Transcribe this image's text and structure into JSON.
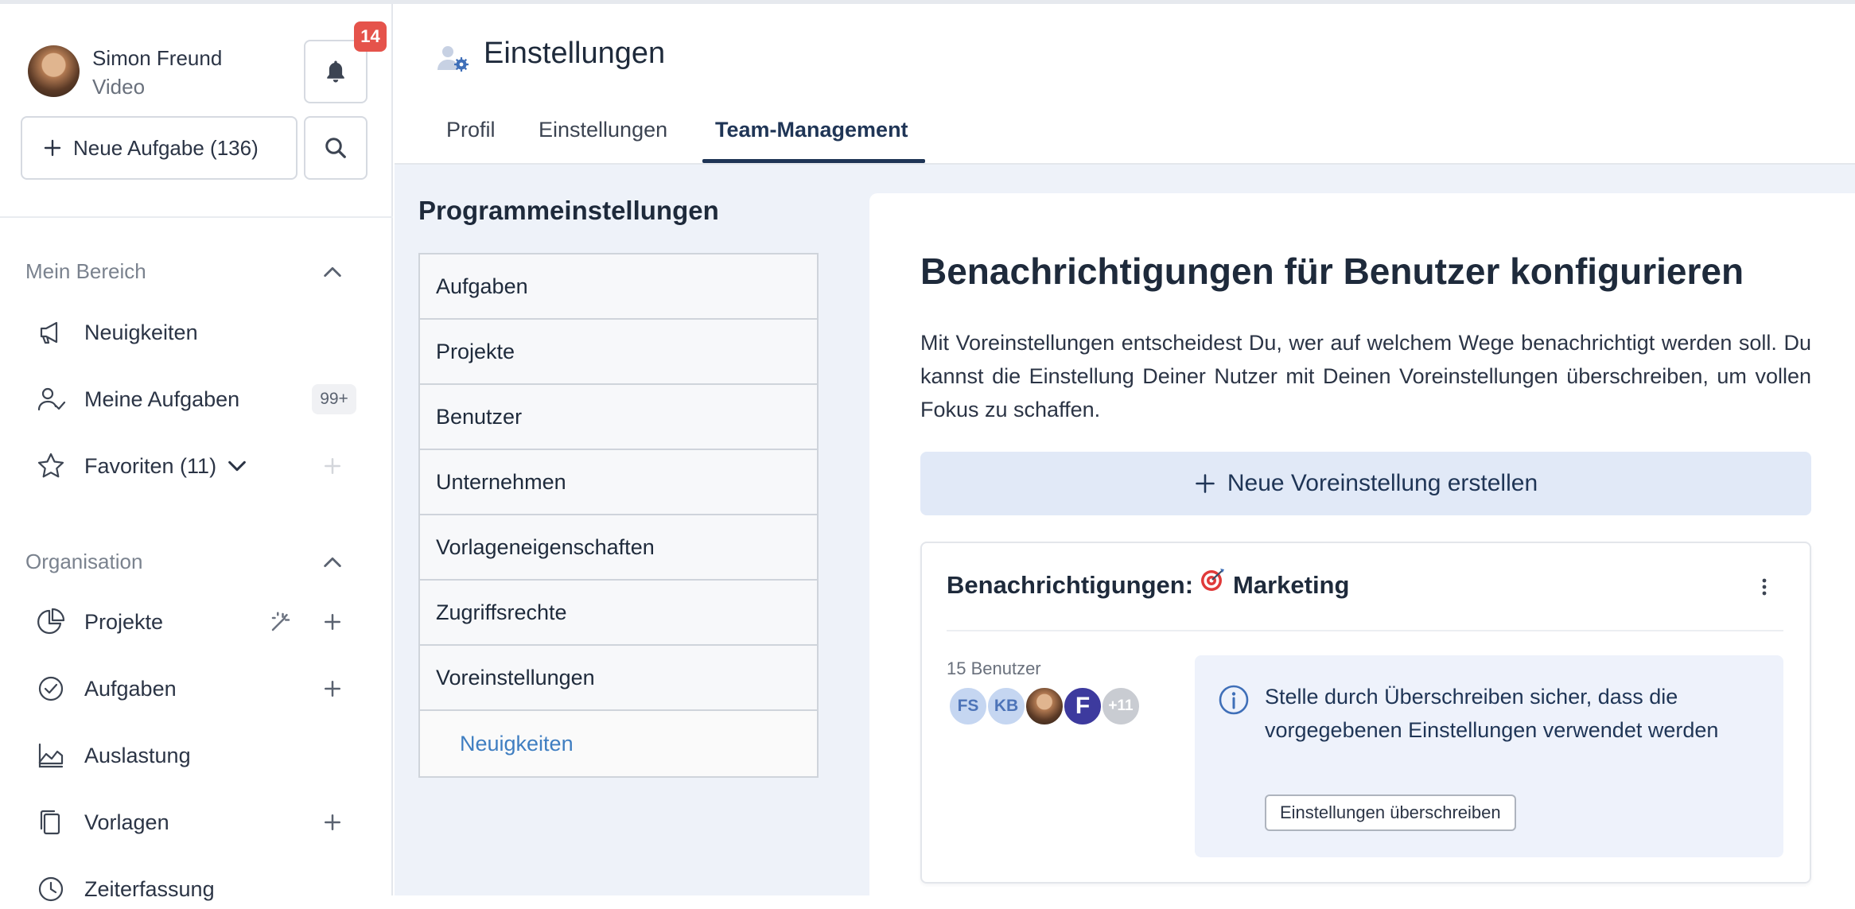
{
  "user": {
    "name": "Simon Freund",
    "role": "Video"
  },
  "notifications": {
    "count": "14"
  },
  "sidebar": {
    "new_task_label": "Neue Aufgabe (136)",
    "my_area": {
      "title": "Mein Bereich",
      "items": [
        {
          "label": "Neuigkeiten",
          "icon": "megaphone-icon"
        },
        {
          "label": "Meine Aufgaben",
          "icon": "user-check-icon",
          "badge": "99+"
        },
        {
          "label": "Favoriten (11)",
          "icon": "star-icon"
        }
      ]
    },
    "organisation": {
      "title": "Organisation",
      "items": [
        {
          "label": "Projekte",
          "icon": "pie-chart-icon"
        },
        {
          "label": "Aufgaben",
          "icon": "check-circle-icon"
        },
        {
          "label": "Auslastung",
          "icon": "area-chart-icon"
        },
        {
          "label": "Vorlagen",
          "icon": "copy-icon"
        },
        {
          "label": "Zeiterfassung",
          "icon": "clock-icon"
        }
      ]
    }
  },
  "header": {
    "title": "Einstellungen",
    "tabs": [
      {
        "label": "Profil"
      },
      {
        "label": "Einstellungen"
      },
      {
        "label": "Team-Management",
        "active": true
      }
    ]
  },
  "program_settings": {
    "title": "Programmeinstellungen",
    "items": [
      {
        "label": "Aufgaben"
      },
      {
        "label": "Projekte"
      },
      {
        "label": "Benutzer"
      },
      {
        "label": "Unternehmen"
      },
      {
        "label": "Vorlageneigenschaften"
      },
      {
        "label": "Zugriffsrechte"
      },
      {
        "label": "Voreinstellungen"
      },
      {
        "label": "Neuigkeiten",
        "sub": true
      }
    ]
  },
  "panel": {
    "title": "Benachrichtigungen für Benutzer konfigurieren",
    "description": "Mit Voreinstellungen entscheidest Du, wer auf welchem Wege benachrichtigt werden soll. Du kannst die Einstellung Deiner Nutzer mit Deinen Voreinstellungen überschreiben, um vollen Fokus zu schaffen.",
    "new_preset_label": "Neue Voreinstellung erstellen",
    "card": {
      "title_prefix": "Benachrichtigungen:",
      "team_name": "Marketing",
      "user_count": "15 Benutzer",
      "avatars": {
        "fs": "FS",
        "kb": "KB",
        "f": "F",
        "more": "+11"
      },
      "info_text": "Stelle durch Überschreiben sicher, dass die vorgegebenen Einstellungen verwendet werden",
      "override_label": "Einstellungen überschreiben"
    }
  },
  "colors": {
    "accent": "#1f3556",
    "badge": "#e5534b",
    "link": "#3f7ec1"
  }
}
